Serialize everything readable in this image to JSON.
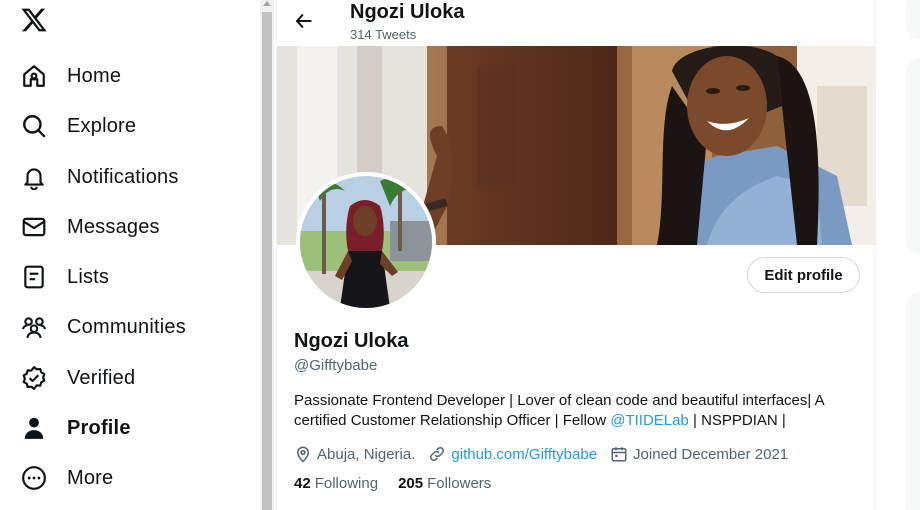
{
  "nav": {
    "items": [
      {
        "label": "Home",
        "icon": "home-icon"
      },
      {
        "label": "Explore",
        "icon": "search-icon"
      },
      {
        "label": "Notifications",
        "icon": "bell-icon"
      },
      {
        "label": "Messages",
        "icon": "envelope-icon"
      },
      {
        "label": "Lists",
        "icon": "list-icon"
      },
      {
        "label": "Communities",
        "icon": "communities-icon"
      },
      {
        "label": "Verified",
        "icon": "verified-icon"
      },
      {
        "label": "Profile",
        "icon": "person-icon"
      },
      {
        "label": "More",
        "icon": "more-circle-icon"
      }
    ]
  },
  "header": {
    "name": "Ngozi Uloka",
    "tweet_count": "314 Tweets"
  },
  "profile": {
    "display_name": "Ngozi Uloka",
    "handle": "@Gifftybabe",
    "edit_label": "Edit profile",
    "bio_before": "Passionate Frontend Developer | Lover of clean code and beautiful interfaces| A certified Customer Relationship Officer | Fellow ",
    "bio_mention": "@TIIDELab",
    "bio_after": " | NSPPDIAN |",
    "location": "Abuja, Nigeria.",
    "website": "github.com/Gifftybabe",
    "joined": "Joined December 2021",
    "following_count": "42",
    "following_label": "Following",
    "followers_count": "205",
    "followers_label": "Followers"
  },
  "colors": {
    "accent": "#1d9bf0",
    "text": "#0f1419",
    "muted": "#536471",
    "border": "#cfd9de"
  }
}
